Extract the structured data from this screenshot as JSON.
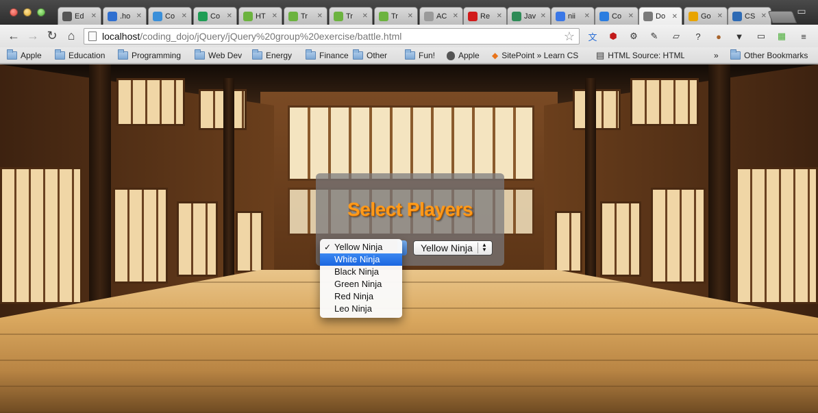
{
  "browser": {
    "tabs": [
      {
        "label": "Ed",
        "fav": "gear-favicon",
        "color": "#555555"
      },
      {
        "label": ".ho",
        "fav": "swirl-favicon",
        "color": "#2f6fd0"
      },
      {
        "label": "Co",
        "fav": "calendar-favicon",
        "color": "#3a8fd9"
      },
      {
        "label": "Co",
        "fav": "sheet-favicon",
        "color": "#1f9d55"
      },
      {
        "label": "HT",
        "fav": "treehouse-favicon",
        "color": "#6cb33f"
      },
      {
        "label": "Tr",
        "fav": "treehouse-favicon",
        "color": "#6cb33f"
      },
      {
        "label": "Tr",
        "fav": "treehouse-favicon",
        "color": "#6cb33f"
      },
      {
        "label": "Tr",
        "fav": "treehouse-favicon",
        "color": "#6cb33f"
      },
      {
        "label": "AC",
        "fav": "document-favicon",
        "color": "#9a9a9a"
      },
      {
        "label": "Re",
        "fav": "red-ball-favicon",
        "color": "#d11a1a"
      },
      {
        "label": "Jav",
        "fav": "plus-favicon",
        "color": "#2e8b57"
      },
      {
        "label": "nii",
        "fav": "google-favicon",
        "color": "#3b78e7"
      },
      {
        "label": "Co",
        "fav": "dropbox-favicon",
        "color": "#2b7de0"
      },
      {
        "label": "Do",
        "fav": "globe-favicon",
        "color": "#7a7a7a"
      },
      {
        "label": "Go",
        "fav": "google-drive-favicon",
        "color": "#e8a400"
      },
      {
        "label": "CS",
        "fav": "w3schools-favicon",
        "color": "#2d6ab4"
      }
    ],
    "active_tab_index": 13,
    "url_host": "localhost",
    "url_path": "/coding_dojo/jQuery/jQuery%20group%20exercise/battle.html",
    "bookmarks": [
      {
        "label": "Apple",
        "icon": "folder-icon"
      },
      {
        "label": "Education",
        "icon": "folder-icon"
      },
      {
        "label": "Programming",
        "icon": "folder-icon"
      },
      {
        "label": "Web Dev",
        "icon": "folder-icon"
      },
      {
        "label": "Energy",
        "icon": "folder-icon"
      },
      {
        "label": "Finance",
        "icon": "folder-icon"
      },
      {
        "label": "Other",
        "icon": "folder-icon"
      },
      {
        "label": "Fun!",
        "icon": "folder-icon"
      },
      {
        "label": "Apple",
        "icon": "apple-icon"
      },
      {
        "label": "SitePoint » Learn CSS",
        "icon": "sitepoint-icon"
      },
      {
        "label": "HTML Source: HTML",
        "icon": "html-icon"
      }
    ],
    "bookmarks_overflow": "»",
    "other_bookmarks": "Other Bookmarks"
  },
  "game": {
    "title": "Select Players",
    "player1_options": [
      "Yellow Ninja",
      "White Ninja",
      "Black Ninja",
      "Green Ninja",
      "Red Ninja",
      "Leo Ninja"
    ],
    "player1_selected": "Yellow Ninja",
    "player1_highlighted": "White Ninja",
    "player2_selected": "Yellow Ninja",
    "checkmark": "✓"
  }
}
